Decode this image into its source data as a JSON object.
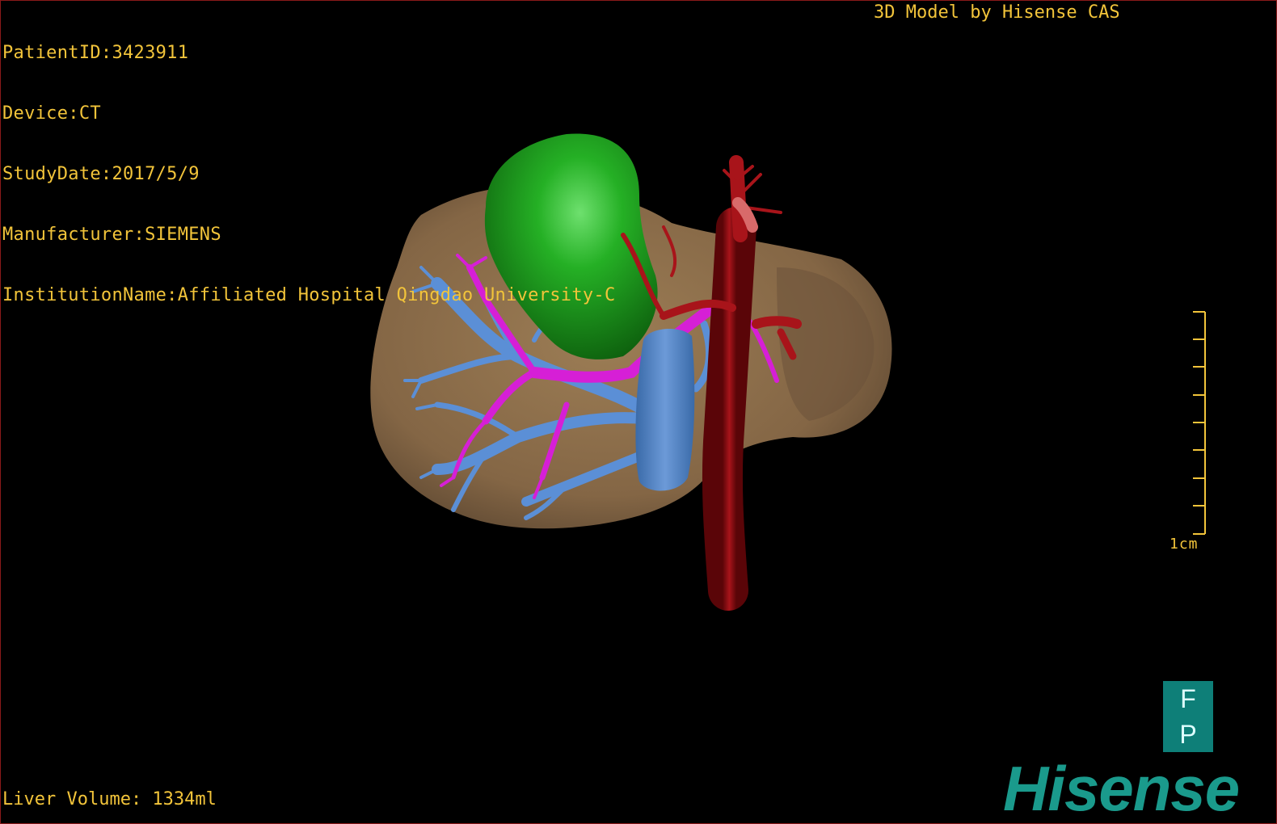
{
  "overlay": {
    "patient_id": "PatientID:3423911",
    "device": "Device:CT",
    "study_date": "StudyDate:2017/5/9",
    "manufacturer": "Manufacturer:SIEMENS",
    "institution": "InstitutionName:Affiliated Hospital Qingdao University-C",
    "model_credit": "3D Model by Hisense CAS",
    "liver_volume": "Liver Volume: 1334ml"
  },
  "scale_bar": {
    "label": "1cm"
  },
  "orientation_cube": {
    "top": "F",
    "bottom": "P"
  },
  "brand": {
    "logo_text": "Hisense"
  },
  "colors": {
    "text": "#f2c43a",
    "liver": "#8a6d4a",
    "tumor": "#1f9a1f",
    "portal_vein": "#d61fd6",
    "hepatic_vein": "#5b8fd6",
    "artery": "#8a0d12",
    "brand": "#1a9a8c"
  },
  "icons": [
    "orientation-cube-icon",
    "scale-bar-icon",
    "hisense-logo"
  ]
}
